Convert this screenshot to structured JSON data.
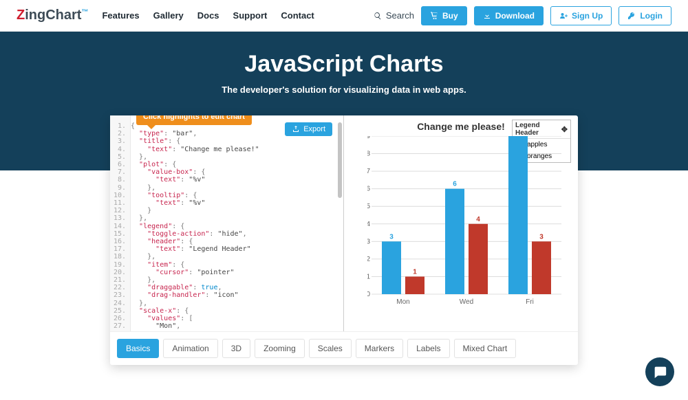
{
  "nav": {
    "logo": {
      "a": "Zing",
      "b": "Chart",
      "tm": "™"
    },
    "items": [
      "Features",
      "Gallery",
      "Docs",
      "Support",
      "Contact"
    ],
    "search": "Search",
    "buy": "Buy",
    "download": "Download",
    "signup": "Sign Up",
    "login": "Login"
  },
  "hero": {
    "title": "JavaScript Charts",
    "subtitle": "The developer's solution for visualizing data in web apps."
  },
  "editor": {
    "tooltip": "Click highlights to edit chart",
    "export": "Export",
    "code_plain": "{\n  \"type\": \"bar\",\n  \"title\": {\n    \"text\": \"Change me please!\"\n  },\n  \"plot\": {\n    \"value-box\": {\n      \"text\": \"%v\"\n    },\n    \"tooltip\": {\n      \"text\": \"%v\"\n    }\n  },\n  \"legend\": {\n    \"toggle-action\": \"hide\",\n    \"header\": {\n      \"text\": \"Legend Header\"\n    },\n    \"item\": {\n      \"cursor\": \"pointer\"\n    },\n    \"draggable\": true,\n    \"drag-handler\": \"icon\"\n  },\n  \"scale-x\": {\n    \"values\": [\n      \"Mon\","
  },
  "legend": {
    "header": "Legend Header",
    "items": [
      "apples",
      "oranges"
    ]
  },
  "tabs": [
    "Basics",
    "Animation",
    "3D",
    "Zooming",
    "Scales",
    "Markers",
    "Labels",
    "Mixed Chart"
  ],
  "chart_data": {
    "type": "bar",
    "title": "Change me please!",
    "categories": [
      "Mon",
      "Wed",
      "Fri"
    ],
    "series": [
      {
        "name": "apples",
        "values": [
          3,
          6,
          9
        ],
        "color": "#2aa3df"
      },
      {
        "name": "oranges",
        "values": [
          1,
          4,
          3
        ],
        "color": "#c0392b"
      }
    ],
    "xlabel": "",
    "ylabel": "",
    "ylim": [
      0,
      9
    ],
    "y_ticks": [
      0,
      1,
      2,
      3,
      4,
      5,
      6,
      7,
      8,
      9
    ],
    "legend_header": "Legend Header",
    "value_box": "%v",
    "tooltip_text": "%v"
  }
}
